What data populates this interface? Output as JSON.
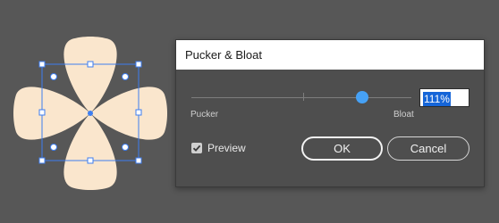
{
  "dialog": {
    "title": "Pucker & Bloat",
    "slider": {
      "left_label": "Pucker",
      "right_label": "Bloat",
      "value_text": "111%"
    },
    "preview": {
      "label": "Preview",
      "checked": true
    },
    "ok_label": "OK",
    "cancel_label": "Cancel"
  },
  "artwork": {
    "shape": "four-petal flower",
    "fill_color": "#fae6cd",
    "selection_color": "#3e7ef0"
  }
}
